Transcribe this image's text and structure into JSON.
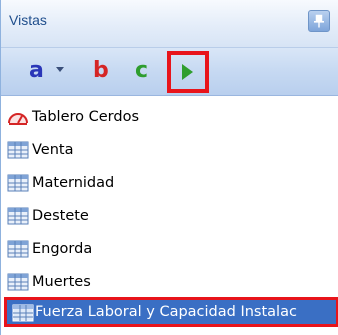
{
  "panel": {
    "title": "Vistas",
    "pin_icon": "pin-icon"
  },
  "toolbar": {
    "a_label": "a",
    "b_label": "b",
    "c_label": "c",
    "play_icon": "play-icon",
    "colors": {
      "a": "#2a36b8",
      "b": "#d52525",
      "c": "#2e9d2e",
      "highlight": "#e8141b"
    }
  },
  "views": [
    {
      "label": "Tablero Cerdos",
      "icon": "gauge-icon"
    },
    {
      "label": "Venta",
      "icon": "table-icon"
    },
    {
      "label": "Maternidad",
      "icon": "table-icon"
    },
    {
      "label": "Destete",
      "icon": "table-icon"
    },
    {
      "label": "Engorda",
      "icon": "table-icon"
    },
    {
      "label": "Muertes",
      "icon": "table-icon"
    }
  ],
  "selected_view": {
    "label": "Fuerza Laboral y Capacidad Instalac",
    "icon": "table-icon"
  }
}
